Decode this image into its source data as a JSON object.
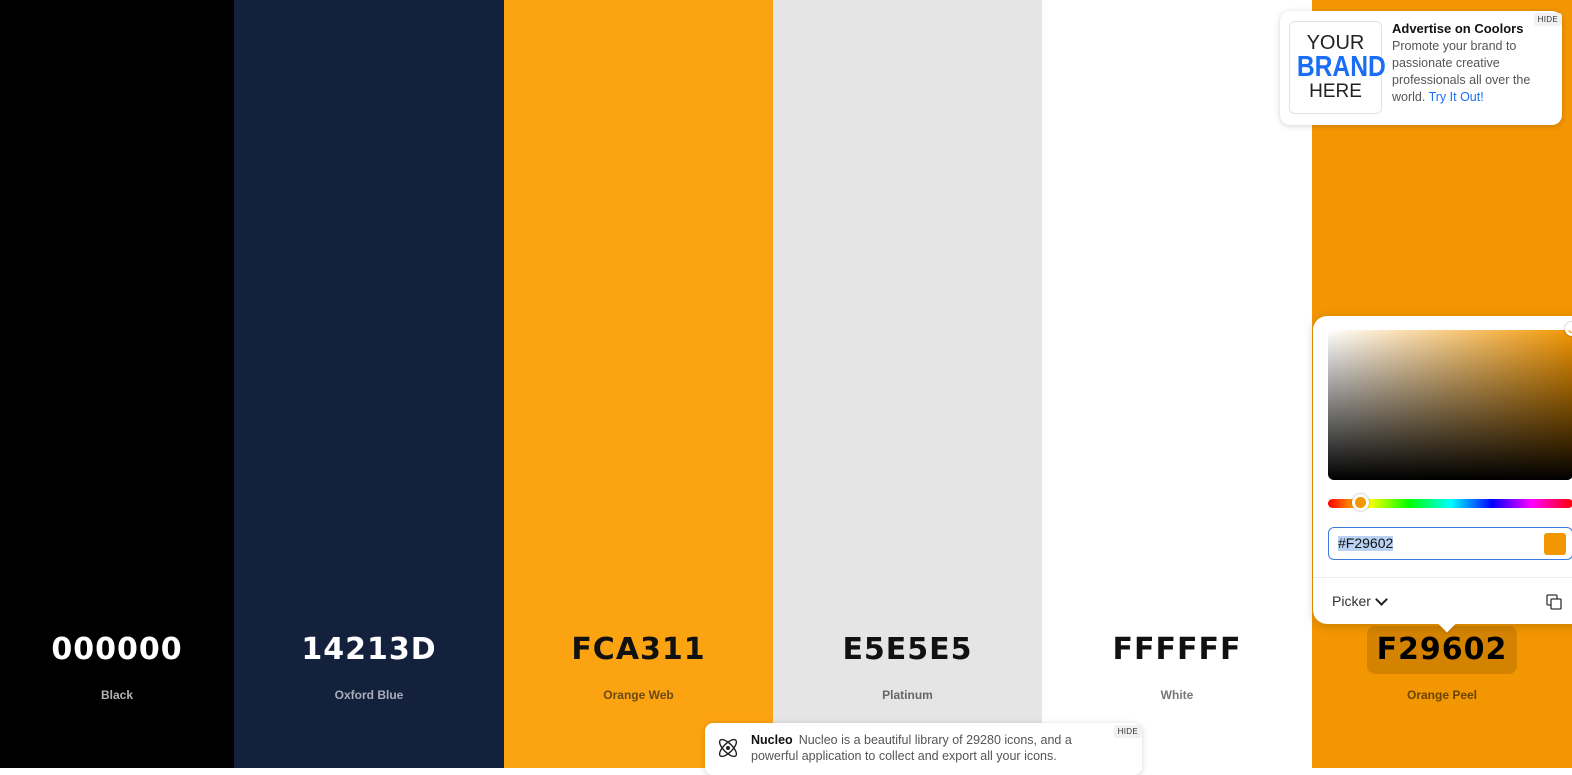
{
  "palette": [
    {
      "hex": "000000",
      "name": "Black",
      "bg": "#000000",
      "hex_color": "#ffffff",
      "name_color": "#b3b3b3"
    },
    {
      "hex": "14213D",
      "name": "Oxford Blue",
      "bg": "#14213d",
      "hex_color": "#ffffff",
      "name_color": "#a8adb8"
    },
    {
      "hex": "FCA311",
      "name": "Orange Web",
      "bg": "#fca311",
      "hex_color": "#111111",
      "name_color": "#6b4a12"
    },
    {
      "hex": "E5E5E5",
      "name": "Platinum",
      "bg": "#e5e5e5",
      "hex_color": "#111111",
      "name_color": "#666666"
    },
    {
      "hex": "FFFFFF",
      "name": "White",
      "bg": "#ffffff",
      "hex_color": "#111111",
      "name_color": "#777777"
    },
    {
      "hex": "F29602",
      "name": "Orange Peel",
      "bg": "#f29602",
      "hex_color": "#111111",
      "name_color": "#6b4400"
    }
  ],
  "ad": {
    "logo_line1": "YOUR",
    "logo_line2": "BRAND",
    "logo_line3": "HERE",
    "title": "Advertise on Coolors",
    "desc": "Promote your brand to passionate creative professionals all over the world.",
    "link": "Try It Out!",
    "hide": "HIDE"
  },
  "picker": {
    "hex_value": "#F29602",
    "mode": "Picker",
    "current_color": "#f29602"
  },
  "nucleo": {
    "title": "Nucleo",
    "desc": "Nucleo is a beautiful library of 29280 icons, and a powerful application to collect and export all your icons.",
    "hide": "HIDE"
  },
  "icons": {
    "copy": "copy-icon",
    "chevron": "chevron-down-icon",
    "nucleo_logo": "nucleo-logo-icon"
  }
}
